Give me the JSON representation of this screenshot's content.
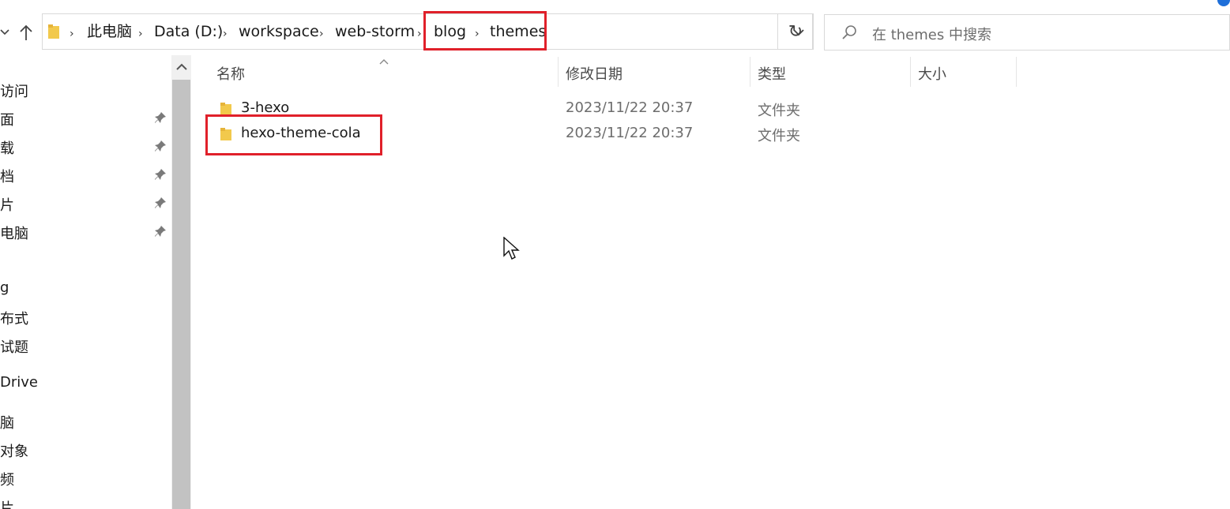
{
  "address_bar": {
    "crumbs": [
      "此电脑",
      "Data (D:)",
      "workspace",
      "web-storm",
      "blog",
      "themes"
    ]
  },
  "search": {
    "placeholder": "在 themes 中搜索"
  },
  "nav_pane": {
    "items": [
      "访问",
      "面",
      "载",
      "档",
      "片",
      "电脑",
      "g",
      "布式",
      "试题",
      "Drive",
      "脑",
      "对象",
      "频",
      "片"
    ]
  },
  "columns": {
    "name": "名称",
    "date": "修改日期",
    "type": "类型",
    "size": "大小"
  },
  "files": [
    {
      "name": "3-hexo",
      "date": "2023/11/22 20:37",
      "type": "文件夹"
    },
    {
      "name": "hexo-theme-cola",
      "date": "2023/11/22 20:37",
      "type": "文件夹"
    }
  ],
  "colors": {
    "highlight": "#e0202a",
    "folder": "#f2c94c",
    "accent": "#1e6fd9"
  }
}
